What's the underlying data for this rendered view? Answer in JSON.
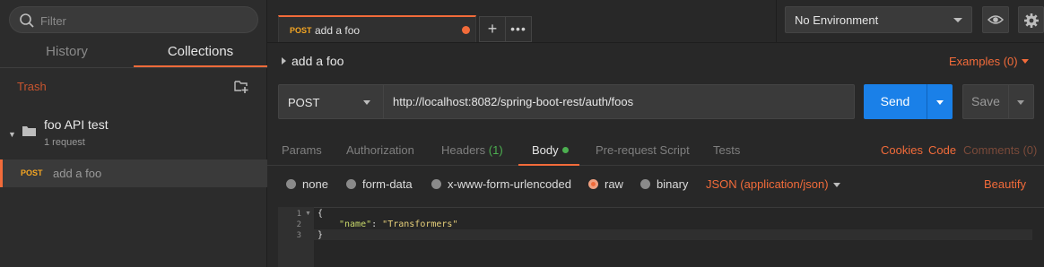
{
  "sidebar": {
    "filter_placeholder": "Filter",
    "tabs": [
      "History",
      "Collections"
    ],
    "active_tab": "Collections",
    "trash_label": "Trash",
    "collection": {
      "name": "foo API test",
      "count": "1 request",
      "requests": [
        {
          "method": "POST",
          "name": "add a foo"
        }
      ]
    }
  },
  "request_tab": {
    "method": "POST",
    "name": "add a foo",
    "unsaved": true
  },
  "environment": {
    "selected": "No Environment"
  },
  "request": {
    "title": "add a foo",
    "examples_label": "Examples (0)",
    "method": "POST",
    "url": "http://localhost:8082/spring-boot-rest/auth/foos",
    "send_label": "Send",
    "save_label": "Save"
  },
  "options": {
    "tabs": {
      "params": "Params",
      "authorization": "Authorization",
      "headers": "Headers",
      "headers_count": "(1)",
      "body": "Body",
      "prerequest": "Pre-request Script",
      "tests": "Tests"
    },
    "active": "Body",
    "links": {
      "cookies": "Cookies",
      "code": "Code",
      "comments": "Comments (0)"
    }
  },
  "body": {
    "modes": [
      "none",
      "form-data",
      "x-www-form-urlencoded",
      "raw",
      "binary"
    ],
    "selected_mode": "raw",
    "content_type": "JSON (application/json)",
    "beautify_label": "Beautify",
    "code": {
      "line_numbers": [
        "1",
        "2",
        "3"
      ],
      "open_brace": "{",
      "key": "\"name\"",
      "colon": ": ",
      "value": "\"Transformers\"",
      "close_brace": "}"
    }
  },
  "colors": {
    "accent": "#f26b3a",
    "send_blue": "#1a80e8",
    "method_post": "#f5a623",
    "success_green": "#4caf50",
    "background": "#282828"
  }
}
